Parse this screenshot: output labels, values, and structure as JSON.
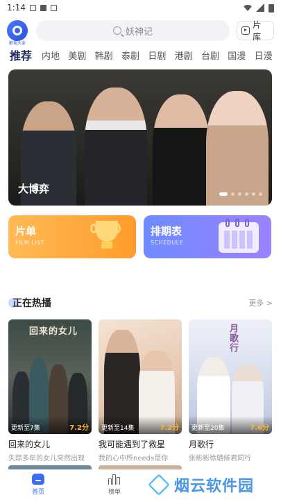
{
  "status_bar": {
    "time": "1:14"
  },
  "header": {
    "logo_text": "影视大全",
    "search_placeholder": "妖神记",
    "library_label": "片库"
  },
  "tabs": [
    "推荐",
    "内地",
    "美剧",
    "韩剧",
    "泰剧",
    "日剧",
    "港剧",
    "台剧",
    "国漫",
    "日漫"
  ],
  "banner": {
    "title": "大博弈",
    "slide_count": 6,
    "active_slide": 1
  },
  "cards": [
    {
      "title": "片单",
      "subtitle": "FILM LIST",
      "color_from": "#ffba55",
      "color_to": "#ff9c2c"
    },
    {
      "title": "排期表",
      "subtitle": "SCHEDULE",
      "color_from": "#6d8bff",
      "color_to": "#9c82ff"
    }
  ],
  "section": {
    "title": "正在热播",
    "more_label": "更多 >"
  },
  "shows": [
    {
      "name": "回来的女儿",
      "desc": "失踪多年的女儿突然出现",
      "episode": "更新至7集",
      "score": "7.2分",
      "poster_title": "回来的女儿"
    },
    {
      "name": "我可能遇到了救星",
      "desc": "我的心中所needs是你",
      "episode": "更新至14集",
      "score": "7.2分",
      "poster_title": ""
    },
    {
      "name": "月歌行",
      "desc": "张彬彬徐璐候君同行",
      "episode": "更新至20集",
      "score": "7.6分",
      "poster_title": "月歌行"
    }
  ],
  "bottom_nav": {
    "home_label": "首页",
    "rank_label": "榜单"
  },
  "watermark": {
    "text": "烟云软件园"
  },
  "colors": {
    "accent": "#3b6cf6",
    "score": "#ffb12b"
  }
}
